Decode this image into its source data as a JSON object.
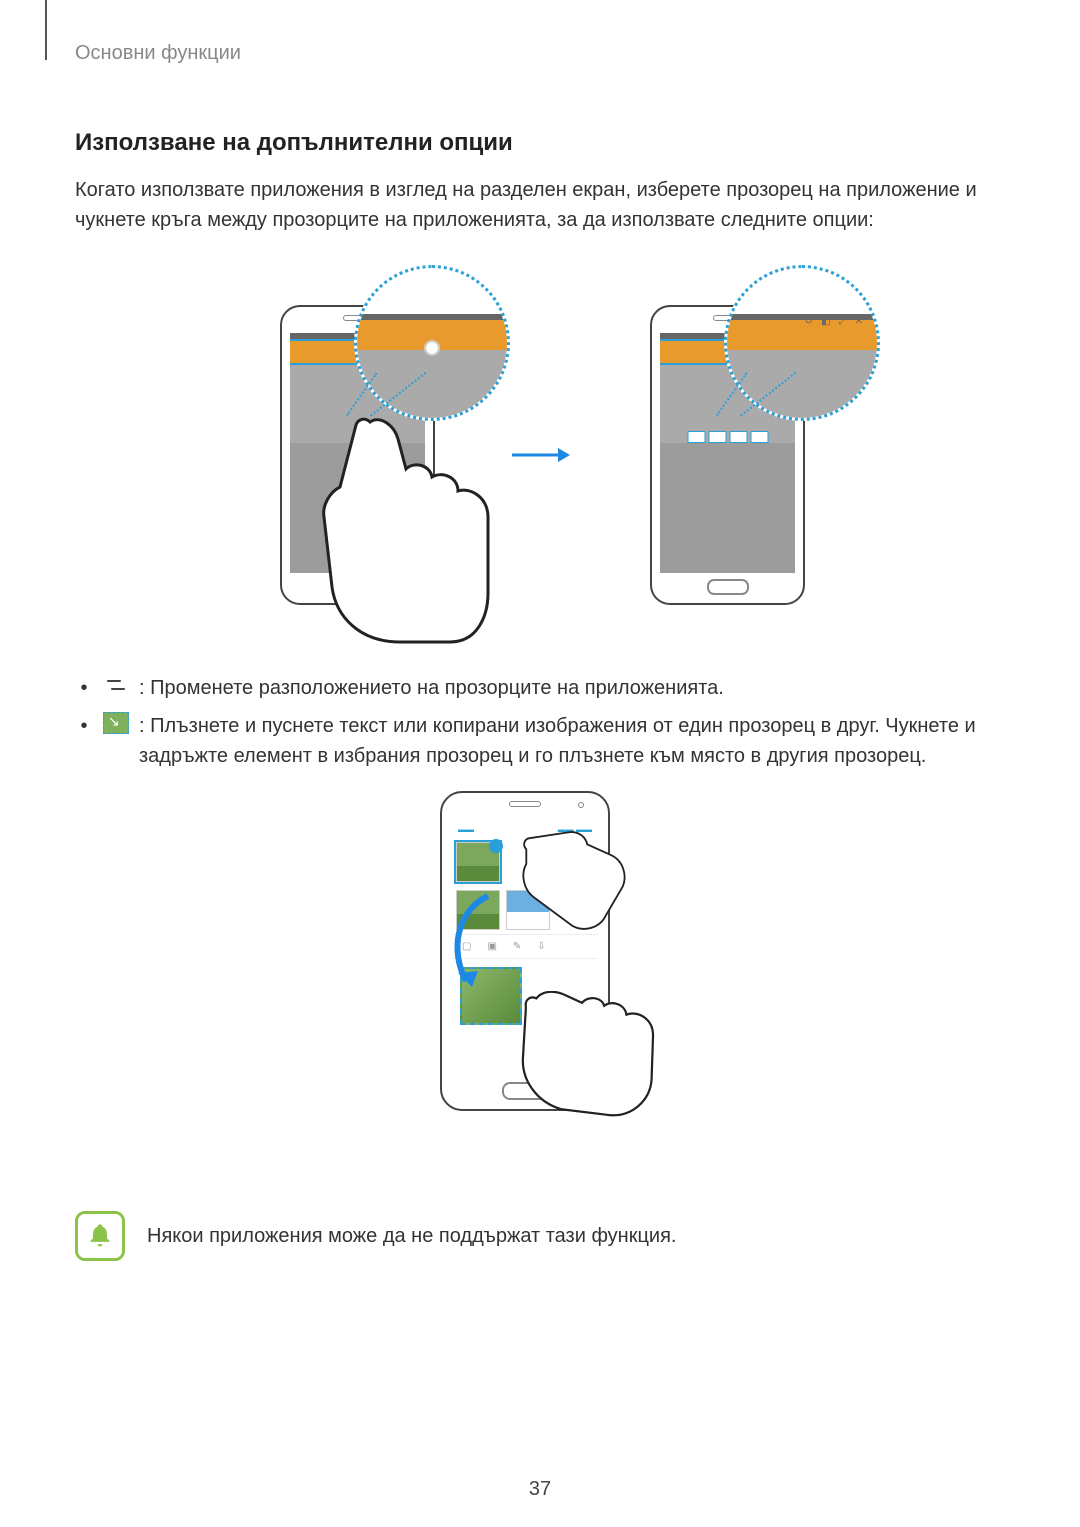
{
  "breadcrumb": "Основни функции",
  "section_title": "Използване на допълнителни опции",
  "intro": "Когато използвате приложения в изглед на разделен екран, изберете прозорец на приложение и чукнете кръга между прозорците на приложенията, за да използвате следните опции:",
  "bullets": [
    {
      "icon": "swap-windows-icon",
      "text": ": Променете разположението на прозорците на приложенията."
    },
    {
      "icon": "drag-content-icon",
      "text": ": Плъзнете и пуснете текст или копирани изображения от един прозорец в друг. Чукнете и задръжте елемент в избрания прозорец и го плъзнете към място в другия прозорец."
    }
  ],
  "note": "Някои приложения може да не поддържат тази функция.",
  "page_number": "37",
  "zoom2_icons": [
    "↺",
    "◧",
    "⤢",
    "✕"
  ]
}
